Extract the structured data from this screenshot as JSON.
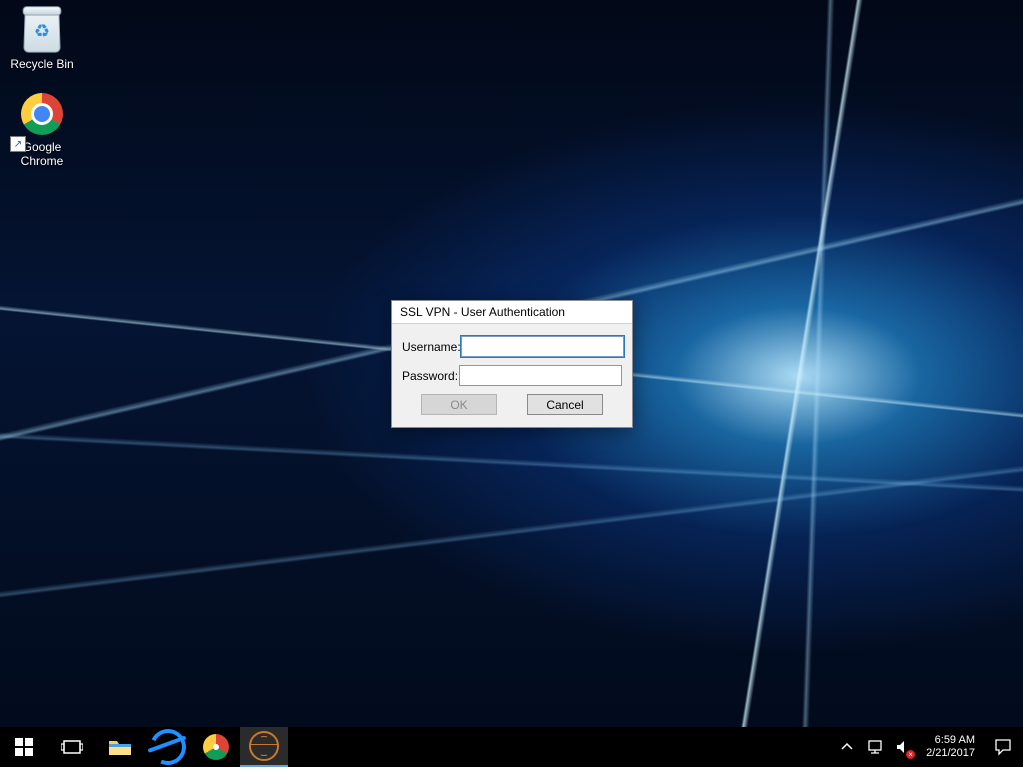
{
  "desktop": {
    "icons": [
      {
        "name": "recycle-bin",
        "label": "Recycle Bin"
      },
      {
        "name": "google-chrome",
        "label": "Google\nChrome"
      }
    ]
  },
  "dialog": {
    "title": "SSL VPN - User Authentication",
    "username_label": "Username:",
    "password_label": "Password:",
    "username_value": "",
    "password_value": "",
    "ok_label": "OK",
    "cancel_label": "Cancel",
    "ok_enabled": false
  },
  "taskbar": {
    "pinned": [
      {
        "name": "start"
      },
      {
        "name": "task-view"
      },
      {
        "name": "file-explorer"
      },
      {
        "name": "internet-explorer"
      },
      {
        "name": "google-chrome"
      },
      {
        "name": "globalprotect",
        "active": true
      }
    ],
    "tray": {
      "show_hidden_tooltip": "Show hidden icons",
      "network": "network-icon",
      "volume_muted": true
    },
    "time": "6:59 AM",
    "date": "2/21/2017"
  }
}
